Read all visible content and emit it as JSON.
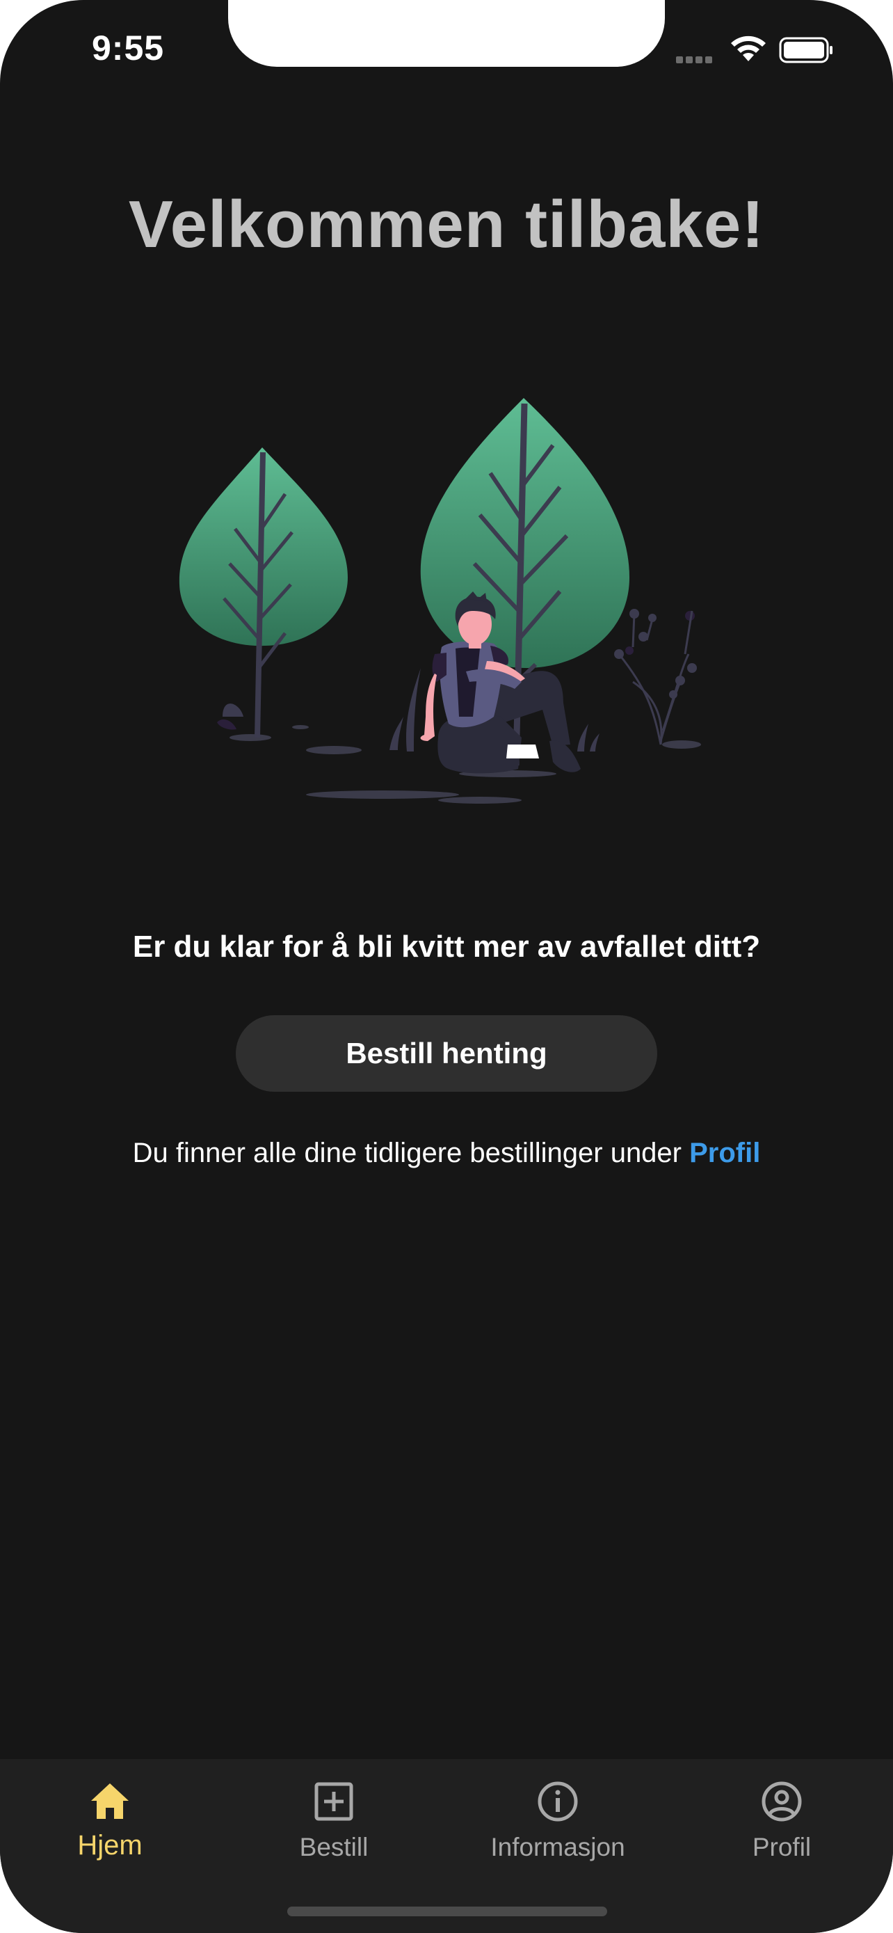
{
  "status_bar": {
    "time": "9:55"
  },
  "home": {
    "title": "Velkommen tilbake!",
    "question": "Er du klar for å bli kvitt mer av avfallet ditt?",
    "order_button_label": "Bestill henting",
    "info_text": "Du finner alle dine tidligere bestillinger under",
    "profile_link_label": "Profil"
  },
  "tab_bar": {
    "tabs": [
      {
        "label": "Hjem",
        "icon": "home-icon",
        "active": true
      },
      {
        "label": "Bestill",
        "icon": "plus-square-icon",
        "active": false
      },
      {
        "label": "Informasjon",
        "icon": "info-icon",
        "active": false
      },
      {
        "label": "Profil",
        "icon": "user-circle-icon",
        "active": false
      }
    ]
  },
  "colors": {
    "background": "#161616",
    "title": "#c2c2c2",
    "accent_link": "#3d9be9",
    "active_tab": "#f6d56b",
    "inactive_tab": "#a8a8a8",
    "button": "#2f2f2f"
  }
}
